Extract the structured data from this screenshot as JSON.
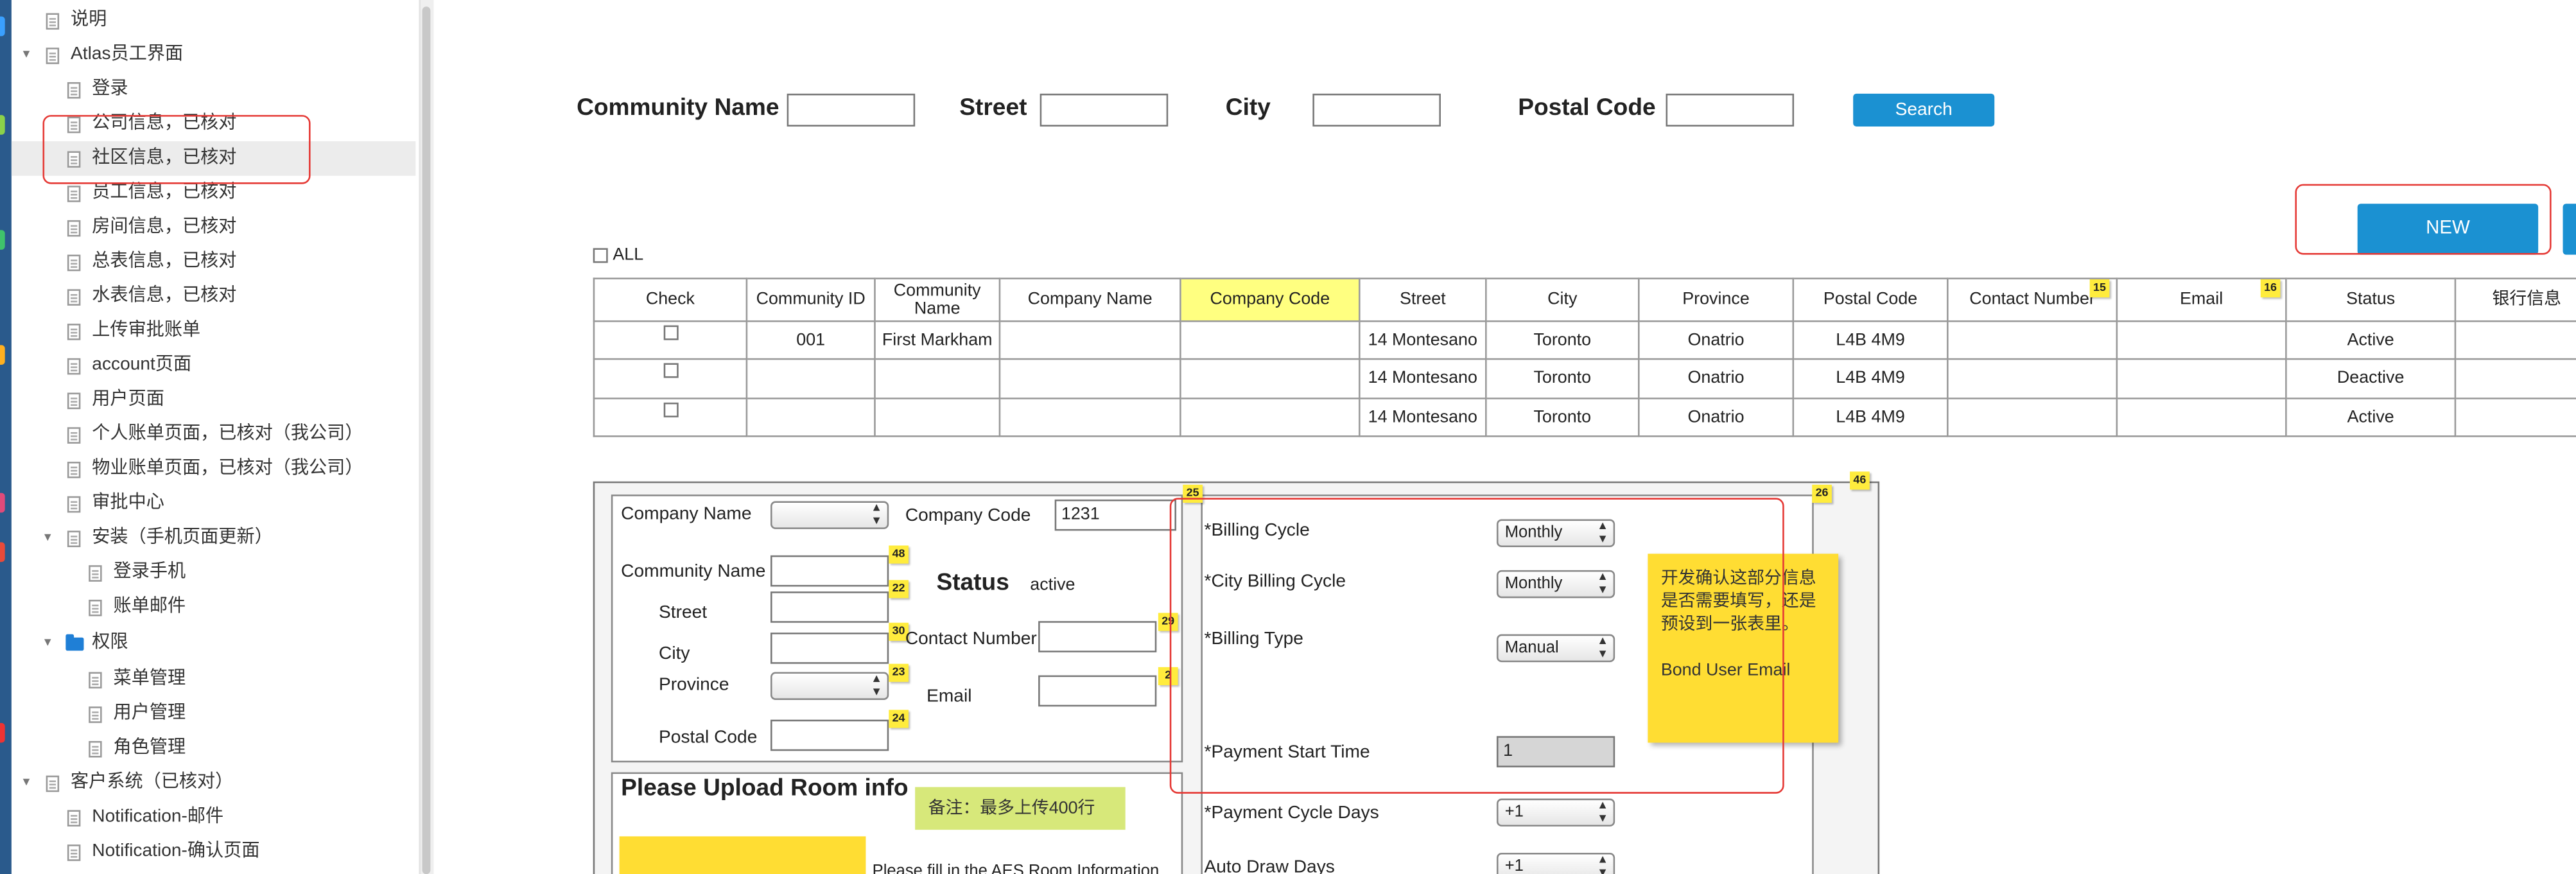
{
  "sidebar": {
    "items": [
      {
        "label": "说明"
      },
      {
        "label": "Atlas员工界面"
      },
      {
        "label": "登录"
      },
      {
        "label": "公司信息，已核对"
      },
      {
        "label": "社区信息，已核对"
      },
      {
        "label": "员工信息，已核对"
      },
      {
        "label": "房间信息，已核对"
      },
      {
        "label": "总表信息，已核对"
      },
      {
        "label": "水表信息，已核对"
      },
      {
        "label": "上传审批账单"
      },
      {
        "label": "account页面"
      },
      {
        "label": "用户页面"
      },
      {
        "label": "个人账单页面，已核对（我公司）"
      },
      {
        "label": "物业账单页面，已核对（我公司）"
      },
      {
        "label": "审批中心"
      },
      {
        "label": "安装（手机页面更新）"
      },
      {
        "label": "登录手机"
      },
      {
        "label": "账单邮件"
      },
      {
        "label": "权限"
      },
      {
        "label": "菜单管理"
      },
      {
        "label": "用户管理"
      },
      {
        "label": "角色管理"
      },
      {
        "label": "客户系统（已核对）"
      },
      {
        "label": "Notification-邮件"
      },
      {
        "label": "Notification-确认页面"
      }
    ]
  },
  "search": {
    "community_name_label": "Community Name",
    "street_label": "Street",
    "city_label": "City",
    "postal_code_label": "Postal Code",
    "search_button": "Search"
  },
  "new_button": "NEW",
  "all_label": "ALL",
  "table": {
    "headers": [
      "Check",
      "Community ID",
      "Community Name",
      "Company Name",
      "Company Code",
      "Street",
      "City",
      "Province",
      "Postal Code",
      "Contact Number",
      "Email",
      "Status",
      "银行信息"
    ],
    "header_badges": {
      "contact_number": "15",
      "email": "16"
    },
    "rows": [
      {
        "community_id": "001",
        "community_name": "First Markham",
        "company_name": "",
        "company_code": "",
        "street": "14 Montesano",
        "city": "Toronto",
        "province": "Onatrio",
        "postal_code": "L4B 4M9",
        "contact_number": "",
        "email": "",
        "status": "Active",
        "bank": ""
      },
      {
        "community_id": "",
        "community_name": "",
        "company_name": "",
        "company_code": "",
        "street": "14 Montesano",
        "city": "Toronto",
        "province": "Onatrio",
        "postal_code": "L4B 4M9",
        "contact_number": "",
        "email": "",
        "status": "Deactive",
        "bank": ""
      },
      {
        "community_id": "",
        "community_name": "",
        "company_name": "",
        "company_code": "",
        "street": "14 Montesano",
        "city": "Toronto",
        "province": "Onatrio",
        "postal_code": "L4B 4M9",
        "contact_number": "",
        "email": "",
        "status": "Active",
        "bank": ""
      }
    ]
  },
  "form": {
    "company_name_label": "Company Name",
    "company_code_label": "Company Code",
    "company_code_value": "1231",
    "community_name_label": "Community Name",
    "street_label": "Street",
    "city_label": "City",
    "province_label": "Province",
    "postal_code_label": "Postal Code",
    "status_label": "Status",
    "status_value": "active",
    "contact_number_label": "Contact Number",
    "email_label": "Email",
    "upload_title": "Please Upload Room info",
    "upload_note": "备注：最多上传400行",
    "upload_hint": "Please fill in the AES Room Information",
    "badges": {
      "b48": "48",
      "b22": "22",
      "b30": "30",
      "b23": "23",
      "b24": "24",
      "b29": "29",
      "b2": "2",
      "b25": "25",
      "b26": "26",
      "b46": "46"
    }
  },
  "billing": {
    "billing_cycle_label": "*Billing Cycle",
    "billing_cycle_value": "Monthly",
    "city_billing_cycle_label": "*City Billing Cycle",
    "city_billing_cycle_value": "Monthly",
    "billing_type_label": "*Billing Type",
    "billing_type_value": "Manual",
    "payment_start_time_label": "*Payment Start Time",
    "payment_start_time_value": "1",
    "payment_cycle_days_label": "*Payment Cycle Days",
    "payment_cycle_days_value": "+1",
    "auto_draw_days_label": "Auto Draw Days",
    "auto_draw_days_value": "+1"
  },
  "sticky_note": {
    "line1": "开发确认这部分信息",
    "line2": "是否需要填写，还是",
    "line3": "预设到一张表里。",
    "line4": "Bond User Email"
  }
}
